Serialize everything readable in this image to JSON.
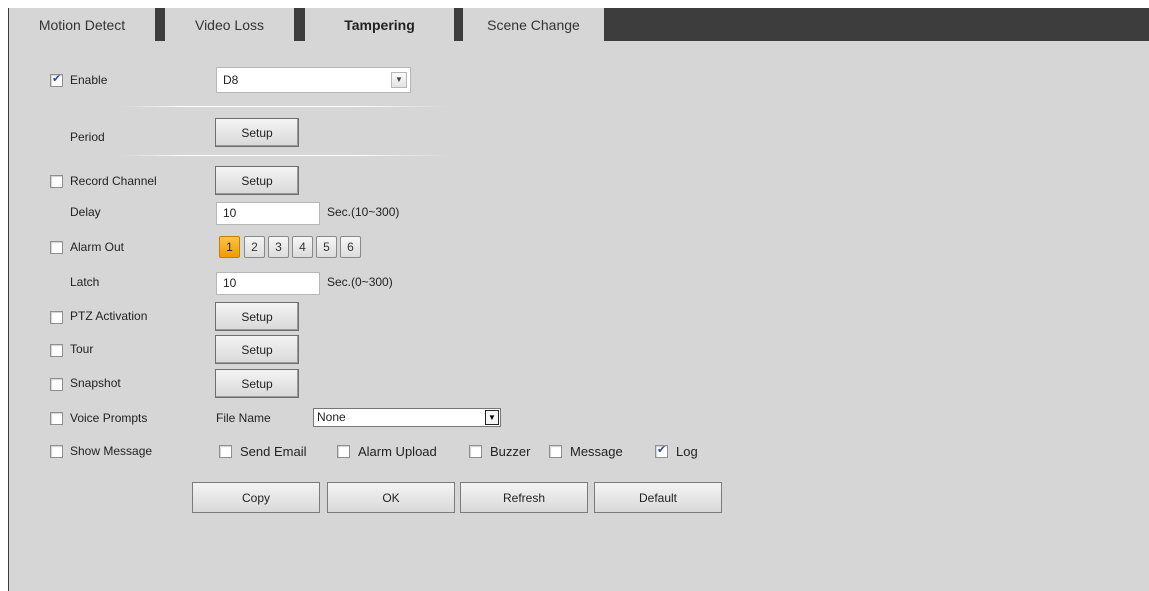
{
  "tabs": [
    {
      "label": "Motion Detect",
      "active": false
    },
    {
      "label": "Video Loss",
      "active": false
    },
    {
      "label": "Tampering",
      "active": true
    },
    {
      "label": "Scene Change",
      "active": false
    }
  ],
  "enable": {
    "label": "Enable",
    "checked": true,
    "channel_value": "D8"
  },
  "period": {
    "label": "Period",
    "button": "Setup"
  },
  "record_channel": {
    "label": "Record Channel",
    "checked": false,
    "button": "Setup"
  },
  "delay": {
    "label": "Delay",
    "value": "10",
    "unit": "Sec.(10~300)"
  },
  "alarm_out": {
    "label": "Alarm Out",
    "checked": false,
    "outputs": [
      {
        "label": "1",
        "selected": true
      },
      {
        "label": "2",
        "selected": false
      },
      {
        "label": "3",
        "selected": false
      },
      {
        "label": "4",
        "selected": false
      },
      {
        "label": "5",
        "selected": false
      },
      {
        "label": "6",
        "selected": false
      }
    ]
  },
  "latch": {
    "label": "Latch",
    "value": "10",
    "unit": "Sec.(0~300)"
  },
  "ptz_activation": {
    "label": "PTZ Activation",
    "checked": false,
    "button": "Setup"
  },
  "tour": {
    "label": "Tour",
    "checked": false,
    "button": "Setup"
  },
  "snapshot": {
    "label": "Snapshot",
    "checked": false,
    "button": "Setup"
  },
  "voice_prompts": {
    "label": "Voice Prompts",
    "checked": false,
    "file_name_label": "File Name",
    "file_value": "None"
  },
  "show_message": {
    "label": "Show Message",
    "checked": false
  },
  "send_email": {
    "label": "Send Email",
    "checked": false
  },
  "alarm_upload": {
    "label": "Alarm Upload",
    "checked": false
  },
  "buzzer": {
    "label": "Buzzer",
    "checked": false
  },
  "message": {
    "label": "Message",
    "checked": false
  },
  "log": {
    "label": "Log",
    "checked": true
  },
  "actions": {
    "copy": "Copy",
    "ok": "OK",
    "refresh": "Refresh",
    "default": "Default"
  },
  "colors": {
    "tabbar": "#3d3d3d",
    "panel": "#d6d6d6",
    "alarm_selected": "#f5a623",
    "check_mark": "#2a4aa0"
  }
}
